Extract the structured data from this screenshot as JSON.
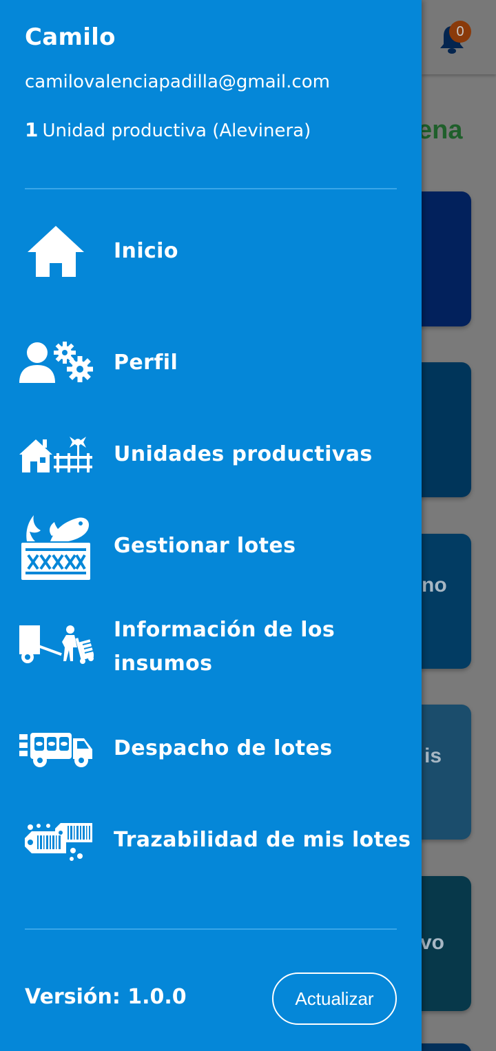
{
  "background": {
    "notification_count": "0",
    "heading_fragment": "ena",
    "card_fragments": [
      "no",
      "is",
      "vo"
    ]
  },
  "drawer": {
    "user_name": "Camilo",
    "user_email": "camilovalenciapadilla@gmail.com",
    "units_count": "1",
    "units_label": "Unidad productiva (Alevinera)",
    "menu": [
      {
        "label": "Inicio",
        "icon": "home-icon"
      },
      {
        "label": "Perfil",
        "icon": "user-settings-icon"
      },
      {
        "label": "Unidades productivas",
        "icon": "farm-icon"
      },
      {
        "label": "Gestionar lotes",
        "icon": "fish-crate-icon"
      },
      {
        "label": "Información de los insumos",
        "icon": "supplies-delivery-icon"
      },
      {
        "label": "Despacho de lotes",
        "icon": "delivery-truck-icon"
      },
      {
        "label": "Trazabilidad de mis lotes",
        "icon": "barcode-tags-icon"
      }
    ],
    "version_label": "Versión: 1.0.0",
    "update_button": "Actualizar"
  },
  "colors": {
    "drawer_bg": "#0587d8",
    "divider": "#3aa6e8",
    "text": "#ffffff"
  }
}
